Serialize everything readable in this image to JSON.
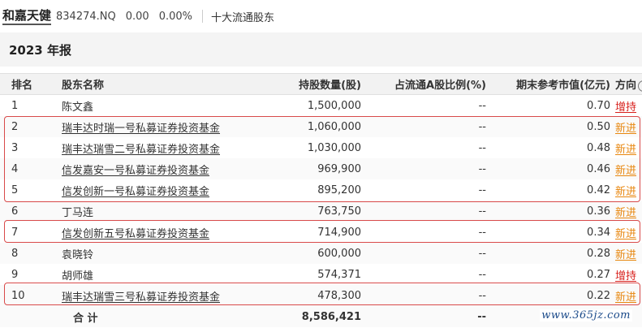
{
  "header": {
    "brand": "和嘉天健",
    "code": "834274.NQ",
    "price": "0.00",
    "change_pct": "0.00%",
    "section": "十大流通股东"
  },
  "report": {
    "title": "2023 年报"
  },
  "table": {
    "columns": {
      "rank": "排名",
      "name": "股东名称",
      "shares": "持股数量(股)",
      "ratio": "占流通A股比例(%)",
      "value": "期末参考市值(亿元)",
      "direction": "方向"
    },
    "rows": [
      {
        "rank": "1",
        "name": "陈文鑫",
        "shares": "1,500,000",
        "ratio": "--",
        "value": "0.70",
        "direction": "增持",
        "underline_name": false
      },
      {
        "rank": "2",
        "name": "瑞丰达时瑞一号私募证券投资基金",
        "shares": "1,060,000",
        "ratio": "--",
        "value": "0.50",
        "direction": "新进",
        "underline_name": true
      },
      {
        "rank": "3",
        "name": "瑞丰达瑞雪二号私募证券投资基金",
        "shares": "1,030,000",
        "ratio": "--",
        "value": "0.48",
        "direction": "新进",
        "underline_name": true
      },
      {
        "rank": "4",
        "name": "信发嘉安一号私募证券投资基金",
        "shares": "969,900",
        "ratio": "--",
        "value": "0.46",
        "direction": "新进",
        "underline_name": true
      },
      {
        "rank": "5",
        "name": "信发创新一号私募证券投资基金",
        "shares": "895,200",
        "ratio": "--",
        "value": "0.42",
        "direction": "新进",
        "underline_name": true
      },
      {
        "rank": "6",
        "name": "丁马连",
        "shares": "763,750",
        "ratio": "--",
        "value": "0.36",
        "direction": "新进",
        "underline_name": false
      },
      {
        "rank": "7",
        "name": "信发创新五号私募证券投资基金",
        "shares": "714,900",
        "ratio": "--",
        "value": "0.34",
        "direction": "新进",
        "underline_name": true
      },
      {
        "rank": "8",
        "name": "袁晓铃",
        "shares": "600,000",
        "ratio": "--",
        "value": "0.28",
        "direction": "新进",
        "underline_name": false
      },
      {
        "rank": "9",
        "name": "胡师雄",
        "shares": "574,371",
        "ratio": "--",
        "value": "0.27",
        "direction": "增持",
        "underline_name": false
      },
      {
        "rank": "10",
        "name": "瑞丰达瑞雪三号私募证券投资基金",
        "shares": "478,300",
        "ratio": "--",
        "value": "0.22",
        "direction": "新进",
        "underline_name": true
      }
    ],
    "total": {
      "label": "合 计",
      "shares": "8,586,421",
      "ratio": "--",
      "value": ""
    }
  },
  "colors": {
    "increase": "#d8201c",
    "new_entry": "#e8870f",
    "highlight_box": "#d94a4a"
  },
  "watermark": "www.365jz.com"
}
